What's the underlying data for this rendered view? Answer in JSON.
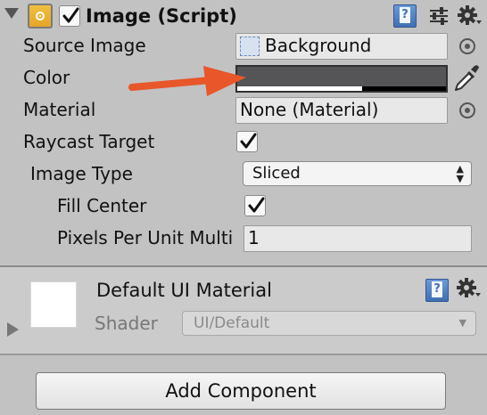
{
  "component": {
    "title": "Image (Script)",
    "enabled": true,
    "icons": {
      "fold": "fold-down-icon",
      "component": "image-component-icon",
      "help": "help-book-icon",
      "presets": "presets-sliders-icon",
      "settings": "gear-icon"
    }
  },
  "properties": {
    "source_image": {
      "label": "Source Image",
      "value": "Background",
      "icon": "sprite-icon"
    },
    "color": {
      "label": "Color",
      "value_hex": "#555558",
      "alpha_percent": 60
    },
    "material": {
      "label": "Material",
      "value": "None (Material)"
    },
    "raycast_target": {
      "label": "Raycast Target",
      "checked": true
    },
    "image_type": {
      "label": "Image Type",
      "value": "Sliced"
    },
    "fill_center": {
      "label": "Fill Center",
      "checked": true
    },
    "pixels_per_unit": {
      "label": "Pixels Per Unit Multi",
      "value": "1"
    }
  },
  "material_section": {
    "title": "Default UI Material",
    "shader_label": "Shader",
    "shader_value": "UI/Default"
  },
  "add_component": {
    "label": "Add Component"
  },
  "annotation": {
    "color": "#e8562a"
  },
  "colors": {
    "inspector_bg": "#c2c2c2",
    "field_bg": "#e8e8e8",
    "checkmark": "#111111"
  }
}
